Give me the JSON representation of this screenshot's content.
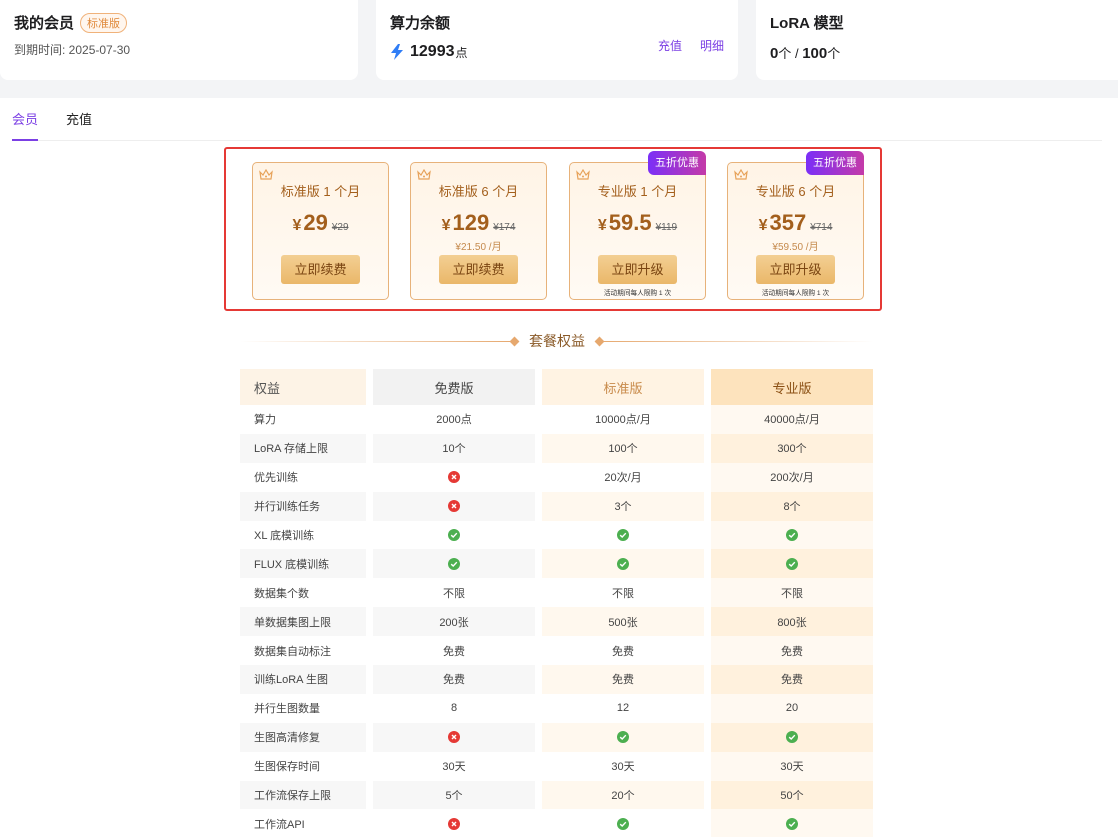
{
  "member": {
    "title": "我的会员",
    "badge": "标准版",
    "expire": "到期时间: 2025-07-30"
  },
  "power": {
    "title": "算力余额",
    "amount": "12993",
    "unit": "点",
    "recharge": "充值",
    "detail": "明细"
  },
  "lora": {
    "title": "LoRA 模型",
    "used": "0",
    "used_unit": "个 / ",
    "total": "100",
    "total_unit": "个"
  },
  "tabs": [
    {
      "label": "会员",
      "active": true
    },
    {
      "label": "充值",
      "active": false
    }
  ],
  "plans": [
    {
      "name": "标准版 1 个月",
      "currency": "¥",
      "price": "29",
      "old": "¥29",
      "per_month": "",
      "button": "立即续费",
      "promo": "",
      "note": ""
    },
    {
      "name": "标准版 6 个月",
      "currency": "¥",
      "price": "129",
      "old": "¥174",
      "per_month": "¥21.50 /月",
      "button": "立即续费",
      "promo": "",
      "note": ""
    },
    {
      "name": "专业版 1 个月",
      "currency": "¥",
      "price": "59.5",
      "old": "¥119",
      "per_month": "",
      "button": "立即升级",
      "promo": "五折优惠",
      "note": "活动期间每人限购 1 次"
    },
    {
      "name": "专业版 6 个月",
      "currency": "¥",
      "price": "357",
      "old": "¥714",
      "per_month": "¥59.50 /月",
      "button": "立即升级",
      "promo": "五折优惠",
      "note": "活动期间每人限购 1 次"
    }
  ],
  "section_title": "套餐权益",
  "table": {
    "headers": [
      "权益",
      "免费版",
      "标准版",
      "专业版"
    ],
    "rows": [
      [
        "算力",
        "2000点",
        "10000点/月",
        "40000点/月"
      ],
      [
        "LoRA 存储上限",
        "10个",
        "100个",
        "300个"
      ],
      [
        "优先训练",
        "no",
        "20次/月",
        "200次/月"
      ],
      [
        "并行训练任务",
        "no",
        "3个",
        "8个"
      ],
      [
        "XL 底模训练",
        "yes",
        "yes",
        "yes"
      ],
      [
        "FLUX 底模训练",
        "yes",
        "yes",
        "yes"
      ],
      [
        "数据集个数",
        "不限",
        "不限",
        "不限"
      ],
      [
        "单数据集图上限",
        "200张",
        "500张",
        "800张"
      ],
      [
        "数据集自动标注",
        "免费",
        "免费",
        "免费"
      ],
      [
        "训练LoRA 生图",
        "免费",
        "免费",
        "免费"
      ],
      [
        "并行生图数量",
        "8",
        "12",
        "20"
      ],
      [
        "生图高清修复",
        "no",
        "yes",
        "yes"
      ],
      [
        "生图保存时间",
        "30天",
        "30天",
        "30天"
      ],
      [
        "工作流保存上限",
        "5个",
        "20个",
        "50个"
      ],
      [
        "工作流API",
        "no",
        "yes",
        "yes"
      ]
    ]
  },
  "colors": {
    "accent": "#7b3fe4",
    "gold": "#a35f1c",
    "yes": "#4caf50",
    "no": "#e53935"
  },
  "icons": {
    "yes": "check-circle-icon",
    "no": "close-circle-icon",
    "power": "lightning-icon",
    "plan": "crown-icon"
  }
}
